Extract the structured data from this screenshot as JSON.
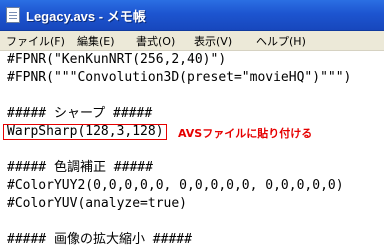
{
  "window": {
    "title": "Legacy.avs - メモ帳"
  },
  "menubar": {
    "items": [
      {
        "label": "ファイル(F)"
      },
      {
        "label": "編集(E)"
      },
      {
        "label": "書式(O)"
      },
      {
        "label": "表示(V)"
      },
      {
        "label": "ヘルプ(H)"
      }
    ]
  },
  "editor": {
    "lines": [
      "#FPNR(\"KenKunNRT(256,2,40)\")",
      "#FPNR(\"\"\"Convolution3D(preset=\"movieHQ\")\"\"\")",
      "",
      "##### シャープ #####",
      "WarpSharp(128,3,128)",
      "",
      "##### 色調補正 #####",
      "#ColorYUY2(0,0,0,0,0, 0,0,0,0,0, 0,0,0,0,0)",
      "#ColorYUV(analyze=true)",
      "",
      "##### 画像の拡大縮小 #####"
    ],
    "annotation": "AVSファイルに貼り付ける",
    "highlight_color": "#e60000"
  }
}
